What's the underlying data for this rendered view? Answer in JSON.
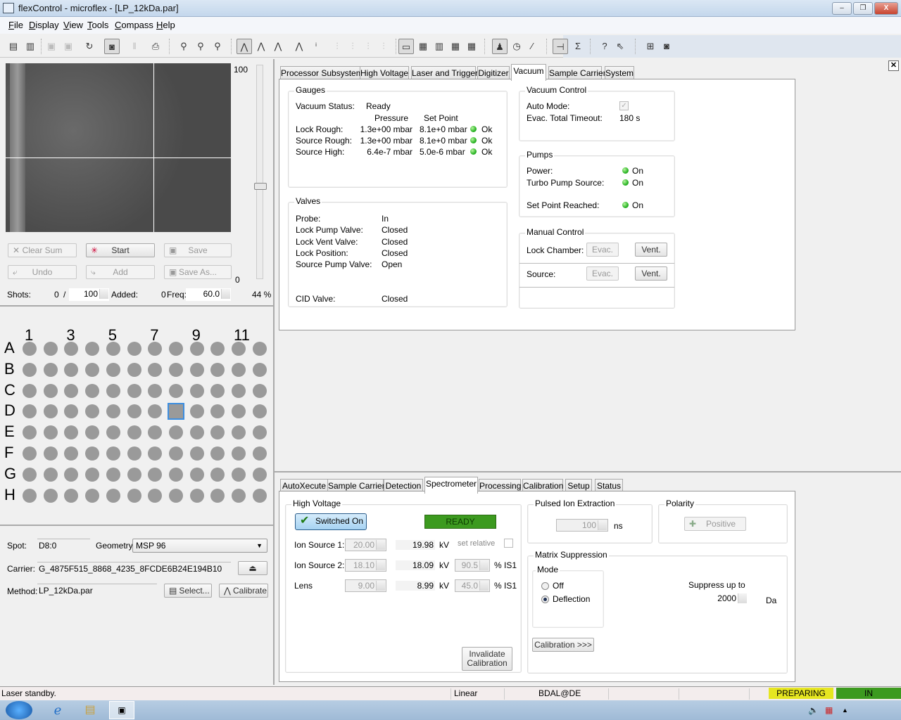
{
  "window": {
    "title": "flexControl - microflex - [LP_12kDa.par]",
    "controls": {
      "minimize": "–",
      "restore": "❐",
      "close": "X"
    }
  },
  "menu": [
    "File",
    "Display",
    "View",
    "Tools",
    "Compass",
    "Help"
  ],
  "toolbar": {
    "icons": [
      "open-method-icon",
      "save-method-icon",
      "save-icon",
      "save-all-icon",
      "refresh-icon",
      "camera-icon",
      "pause-icon",
      "print-icon",
      "zoom-icon",
      "zoom-x-icon",
      "zoom-reset-icon",
      "peak-select-icon",
      "peak-down-icon",
      "peak-label-icon",
      "peak-annotate-icon",
      "peak-info-icon",
      "spectrum-1-icon",
      "spectrum-2-icon",
      "spectrum-3-icon",
      "spectrum-4-icon",
      "layout-1-icon",
      "layout-2-icon",
      "layout-3-icon",
      "layout-4-icon",
      "layout-5-icon",
      "user-icon",
      "clock-icon",
      "calibrate-icon",
      "panel-1-icon",
      "panel-sigma-icon",
      "help-icon",
      "context-help-icon",
      "window-icon",
      "camera-off-icon"
    ]
  },
  "laser": {
    "slider_max": "100",
    "slider_min": "0",
    "slider_percent": "44 %",
    "slider_value_percent": 44,
    "buttons": {
      "clear_sum": "Clear Sum",
      "start": "Start",
      "save": "Save",
      "undo": "Undo",
      "add": "Add",
      "save_as": "Save As..."
    },
    "shots_label": "Shots:",
    "shots_current": "0",
    "shots_sep": "/",
    "shots_total": "100",
    "added_label": "Added:",
    "added_value": "0",
    "freq_label": "Freq:",
    "freq_value": "60.0"
  },
  "plate": {
    "columns_labels": [
      "1",
      "3",
      "5",
      "7",
      "9",
      "11"
    ],
    "rows": [
      "A",
      "B",
      "C",
      "D",
      "E",
      "F",
      "G",
      "H"
    ],
    "selected": "D8"
  },
  "spot": {
    "spot_label": "Spot:",
    "spot_value": "D8:0",
    "geometry_label": "Geometry:",
    "geometry_value": "MSP 96",
    "carrier_label": "Carrier:",
    "carrier_value": "G_4875F515_8868_4235_8FCDE6B24E194B10",
    "method_label": "Method:",
    "method_value": "LP_12kDa.par",
    "select_button": "Select...",
    "calibrate_button": "Calibrate"
  },
  "top_tabs": [
    "Processor Subsystem",
    "High Voltage",
    "Laser and Trigger",
    "Digitizer",
    "Vacuum",
    "Sample Carrier",
    "System"
  ],
  "top_active_tab": "Vacuum",
  "vacuum": {
    "gauges": {
      "title": "Gauges",
      "status_label": "Vacuum Status:",
      "status_value": "Ready",
      "col_pressure": "Pressure",
      "col_setpoint": "Set Point",
      "rows": [
        {
          "label": "Lock Rough:",
          "pressure": "1.3e+00 mbar",
          "setpoint": "8.1e+0 mbar",
          "state": "Ok"
        },
        {
          "label": "Source Rough:",
          "pressure": "1.3e+00 mbar",
          "setpoint": "8.1e+0 mbar",
          "state": "Ok"
        },
        {
          "label": "Source High:",
          "pressure": "6.4e-7 mbar",
          "setpoint": "5.0e-6 mbar",
          "state": "Ok"
        }
      ]
    },
    "valves": {
      "title": "Valves",
      "rows": [
        {
          "label": "Probe:",
          "value": "In"
        },
        {
          "label": "Lock Pump Valve:",
          "value": "Closed"
        },
        {
          "label": "Lock Vent Valve:",
          "value": "Closed"
        },
        {
          "label": "Lock Position:",
          "value": "Closed"
        },
        {
          "label": "Source Pump Valve:",
          "value": "Open"
        },
        {
          "label": "CID Valve:",
          "value": "Closed"
        }
      ]
    },
    "control": {
      "title": "Vacuum Control",
      "auto_mode_label": "Auto Mode:",
      "auto_mode_checked": true,
      "timeout_label": "Evac. Total Timeout:",
      "timeout_value": "180 s"
    },
    "pumps": {
      "title": "Pumps",
      "rows": [
        {
          "label": "Power:",
          "value": "On"
        },
        {
          "label": "Turbo Pump Source:",
          "value": "On"
        },
        {
          "label": "Set Point Reached:",
          "value": "On"
        }
      ]
    },
    "manual": {
      "title": "Manual Control",
      "lock_label": "Lock Chamber:",
      "source_label": "Source:",
      "evac": "Evac.",
      "vent": "Vent."
    }
  },
  "bottom_tabs": [
    "AutoXecute",
    "Sample Carrier",
    "Detection",
    "Spectrometer",
    "Processing",
    "Calibration",
    "Setup",
    "Status"
  ],
  "bottom_active_tab": "Spectrometer",
  "spectrometer": {
    "hv": {
      "title": "High Voltage",
      "switched_on": "Switched On",
      "ready": "READY",
      "set_relative": "set relative",
      "rows": [
        {
          "label": "Ion Source 1:",
          "set": "20.00",
          "actual": "19.98",
          "unit": "kV",
          "rel": "",
          "rel_unit": ""
        },
        {
          "label": "Ion Source 2:",
          "set": "18.10",
          "actual": "18.09",
          "unit": "kV",
          "rel": "90.5",
          "rel_unit": "% IS1"
        },
        {
          "label": "Lens",
          "set": "9.00",
          "actual": "8.99",
          "unit": "kV",
          "rel": "45.0",
          "rel_unit": "% IS1"
        }
      ],
      "invalidate_line1": "Invalidate",
      "invalidate_line2": "Calibration"
    },
    "pie": {
      "title": "Pulsed Ion Extraction",
      "value": "100",
      "unit": "ns"
    },
    "polarity": {
      "title": "Polarity",
      "value": "Positive"
    },
    "matrix": {
      "title": "Matrix Suppression",
      "mode_title": "Mode",
      "off": "Off",
      "deflection": "Deflection",
      "selected": "Deflection",
      "suppress_label": "Suppress up to",
      "suppress_value": "2000",
      "suppress_unit": "Da",
      "calibration_button": "Calibration >>>"
    }
  },
  "statusbar": {
    "message": "Laser standby.",
    "mode": "Linear",
    "user": "BDAL@DE",
    "state1": "PREPARING",
    "state2": "IN",
    "state1_color": "#e6e620",
    "state2_color": "#3c9a1f"
  }
}
